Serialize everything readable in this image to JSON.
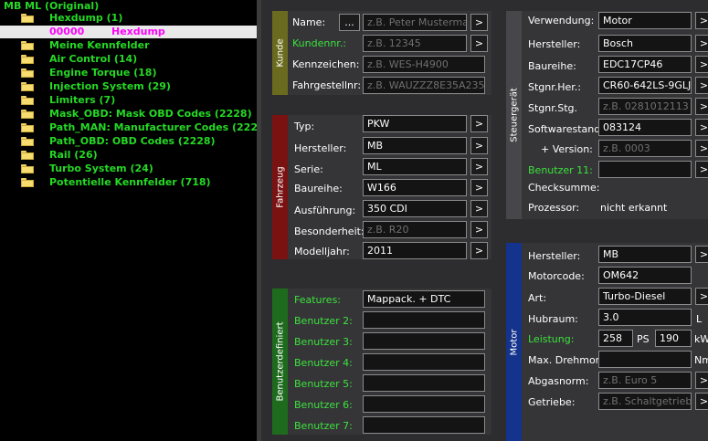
{
  "tree": {
    "root": "MB ML (Original)",
    "hexdump_folder": "Hexdump (1)",
    "hex_selected": {
      "addr": "00000",
      "name": "Hexdump"
    },
    "folders": [
      "Meine Kennfelder",
      "Air Control (14)",
      "Engine Torque (18)",
      "Injection System (29)",
      "Limiters (7)",
      "Mask_OBD: Mask OBD Codes (2228)",
      "Path_MAN: Manufacturer Codes (2228)",
      "Path_OBD: OBD Codes (2228)",
      "Rail (26)",
      "Turbo System (24)",
      "Potentielle Kennfelder (718)"
    ]
  },
  "groups": {
    "kunde": "Kunde",
    "fahrzeug": "Fahrzeug",
    "benutzer": "Benutzerdefiniert",
    "steuergeraet": "Steuergerät",
    "motor": "Motor"
  },
  "kunde": {
    "name_label": "Name:",
    "name_btn": "...",
    "name_ph": "z.B. Peter Mustermann",
    "kundennr_label": "Kundennr.:",
    "kundennr_ph": "z.B. 12345",
    "kennzeichen_label": "Kennzeichen:",
    "kennzeichen_ph": "z.B. WES-H4900",
    "fahrgestellnr_label": "Fahrgestellnr:",
    "fahrgestellnr_ph": "z.B. WAUZZZ8E35A235"
  },
  "fahrzeug": {
    "typ_label": "Typ:",
    "typ_value": "PKW",
    "hersteller_label": "Hersteller:",
    "hersteller_value": "MB",
    "serie_label": "Serie:",
    "serie_value": "ML",
    "baureihe_label": "Baureihe:",
    "baureihe_value": "W166",
    "ausfuehrung_label": "Ausführung:",
    "ausfuehrung_value": "350 CDI",
    "besonderheit_label": "Besonderheit:",
    "besonderheit_ph": "z.B. R20",
    "modelljahr_label": "Modelljahr:",
    "modelljahr_value": "2011"
  },
  "benutzer": {
    "features_label": "Features:",
    "features_value": "Mappack. + DTC",
    "b2": "Benutzer 2:",
    "b3": "Benutzer 3:",
    "b4": "Benutzer 4:",
    "b5": "Benutzer 5:",
    "b6": "Benutzer 6:",
    "b7": "Benutzer 7:"
  },
  "steuergeraet": {
    "verwendung_label": "Verwendung:",
    "verwendung_value": "Motor",
    "hersteller_label": "Hersteller:",
    "hersteller_value": "Bosch",
    "baureihe_label": "Baureihe:",
    "baureihe_value": "EDC17CP46",
    "stgnr_her_label": "Stgnr.Her.:",
    "stgnr_her_value": "CR60-642LS-9GLJ-C",
    "stgnr_stg_label": "Stgnr.Stg.",
    "stgnr_stg_ph": "z.B. 0281012113",
    "software_label": "Softwarestand:",
    "software_value": "083124",
    "version_label": "+ Version:",
    "version_ph": "z.B. 0003",
    "benutzer11_label": "Benutzer 11:",
    "checksumme_label": "Checksumme:",
    "prozessor_label": "Prozessor:",
    "prozessor_value": "nicht erkannt"
  },
  "motor": {
    "hersteller_label": "Hersteller:",
    "hersteller_value": "MB",
    "motorcode_label": "Motorcode:",
    "motorcode_value": "OM642",
    "art_label": "Art:",
    "art_value": "Turbo-Diesel",
    "hubraum_label": "Hubraum:",
    "hubraum_value": "3.0",
    "hubraum_unit": "L",
    "leistung_label": "Leistung:",
    "leistung_ps": "258",
    "ps_unit": "PS",
    "leistung_kw": "190",
    "kw_unit": "kW",
    "drehmom_label": "Max. Drehmom.",
    "nm_unit": "Nm",
    "abgasnorm_label": "Abgasnorm:",
    "abgasnorm_ph": "z.B. Euro 5",
    "getriebe_label": "Getriebe:",
    "getriebe_ph": "z.B. Schaltgetriebe"
  },
  "common": {
    "arrow": ">"
  },
  "colors": {
    "kunde": "#6b6b1f",
    "fahrzeug": "#7a1212",
    "benutzer": "#1e6b1e",
    "motor": "#13338c",
    "steuer": "#47474b"
  }
}
